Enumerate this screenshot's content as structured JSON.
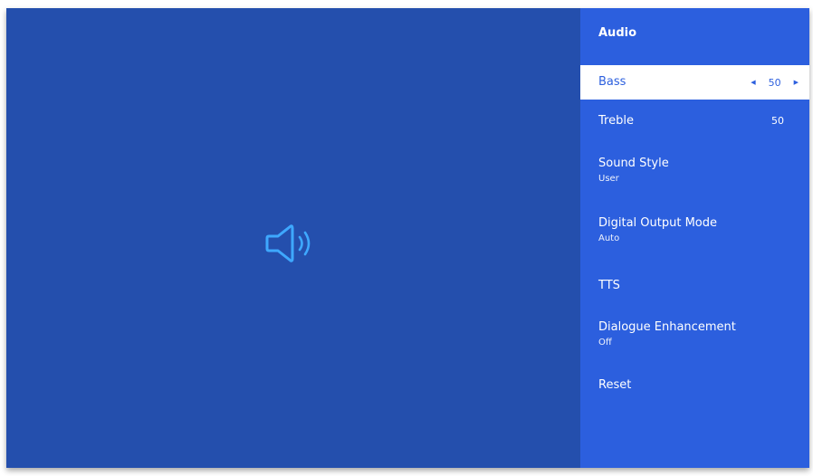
{
  "menu": {
    "title": "Audio",
    "items": [
      {
        "label": "Bass",
        "value": "50",
        "selected": true
      },
      {
        "label": "Treble",
        "value": "50"
      },
      {
        "label": "Sound Style",
        "sub": "User"
      },
      {
        "label": "Digital Output Mode",
        "sub": "Auto"
      },
      {
        "label": "TTS"
      },
      {
        "label": "Dialogue Enhancement",
        "sub": "Off"
      },
      {
        "label": "Reset"
      }
    ],
    "stepper": {
      "left_icon": "arrow-left-icon",
      "right_icon": "arrow-right-icon"
    }
  },
  "preview": {
    "icon": "speaker-icon",
    "icon_color": "#3ea8ff"
  },
  "colors": {
    "background": "#244fad",
    "menu": "#2c5fde",
    "selected_bg": "#ffffff",
    "text": "#ffffff"
  }
}
